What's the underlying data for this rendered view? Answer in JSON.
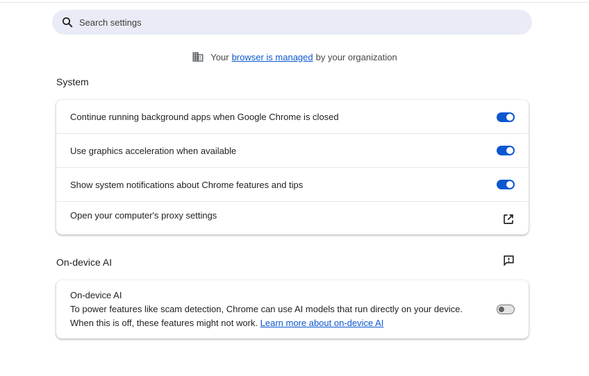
{
  "search": {
    "placeholder": "Search settings"
  },
  "managed_notice": {
    "prefix": "Your",
    "link": "browser is managed",
    "suffix": "by your organization"
  },
  "system": {
    "title": "System",
    "rows": [
      {
        "label": "Continue running background apps when Google Chrome is closed",
        "enabled": true
      },
      {
        "label": "Use graphics acceleration when available",
        "enabled": true
      },
      {
        "label": "Show system notifications about Chrome features and tips",
        "enabled": true
      },
      {
        "label": "Open your computer's proxy settings"
      }
    ]
  },
  "on_device_ai": {
    "title": "On-device AI",
    "row_title": "On-device AI",
    "description_line1": "To power features like scam detection, Chrome can use AI models that run directly on your device.",
    "description_line2": "When this is off, these features might not work.",
    "learn_more": "Learn more about on-device AI",
    "enabled": false
  },
  "icons": {
    "search": "search-icon",
    "managed": "building-icon",
    "external": "open-in-new-icon",
    "feedback": "feedback-icon"
  },
  "colors": {
    "accent": "#0b57d0",
    "search_bg": "#e9ecf6",
    "toggle_off_bg": "#e3e3e3"
  }
}
